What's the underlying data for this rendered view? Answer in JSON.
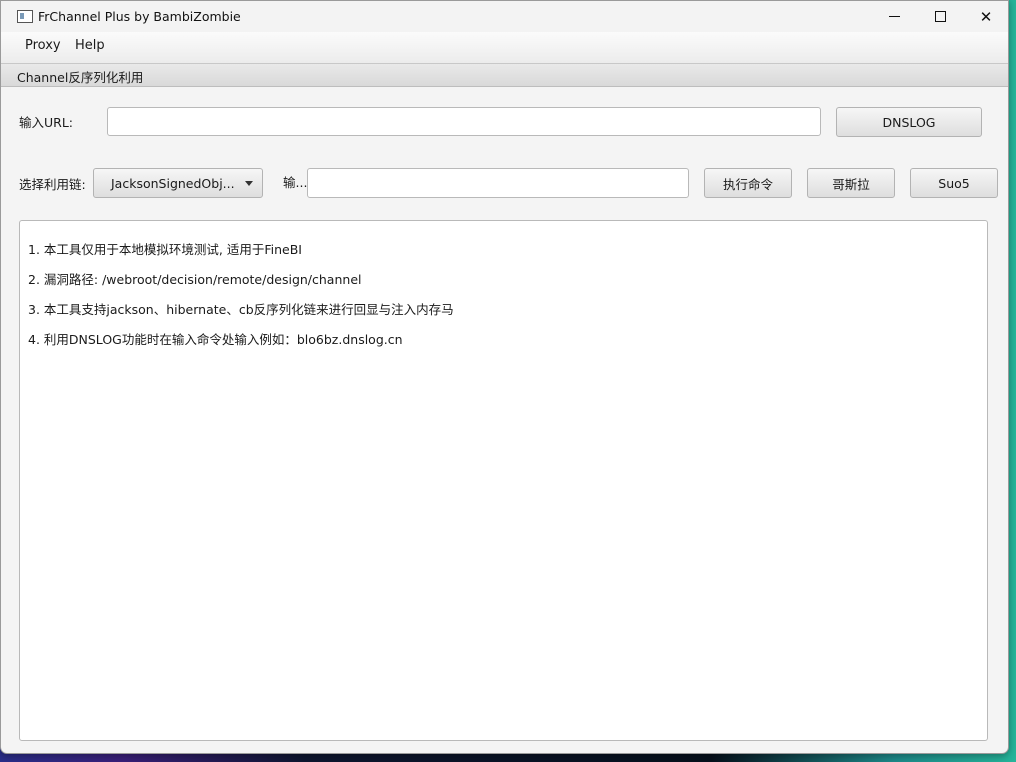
{
  "window": {
    "title": "FrChannel Plus by BambiZombie"
  },
  "menu": {
    "items": [
      "Proxy",
      "Help"
    ]
  },
  "tab": {
    "label": "Channel反序列化利用"
  },
  "url_row": {
    "label": "输入URL:",
    "url_value": "",
    "dnslog_button": "DNSLOG"
  },
  "chain_row": {
    "label": "选择利用链:",
    "chain_selected": "JacksonSignedObj...",
    "cmd_label": "输...",
    "cmd_value": "",
    "exec_button": "执行命令",
    "godzilla_button": "哥斯拉",
    "suo5_button": "Suo5"
  },
  "output": {
    "lines": [
      "1. 本工具仅用于本地模拟环境测试, 适用于FineBI",
      "2. 漏洞路径: /webroot/decision/remote/design/channel",
      "3. 本工具支持jackson、hibernate、cb反序列化链来进行回显与注入内存马",
      "4. 利用DNSLOG功能时在输入命令处输入例如：blo6bz.dnslog.cn"
    ]
  },
  "icons": {
    "app": "app-window-icon",
    "minimize": "minimize-icon",
    "maximize": "maximize-icon",
    "close": "close-icon",
    "dropdown": "chevron-down-icon"
  }
}
